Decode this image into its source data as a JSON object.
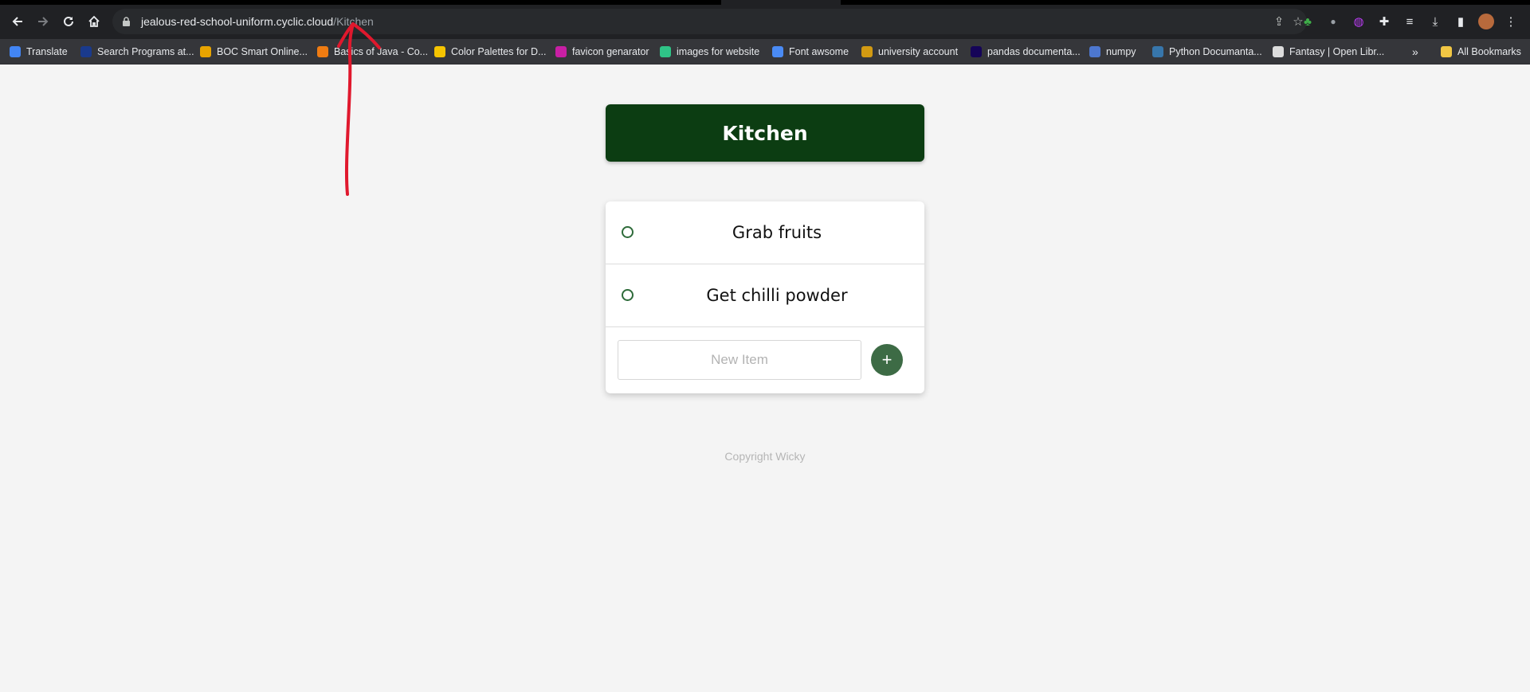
{
  "browser": {
    "url_host": "jealous-red-school-uniform.cyclic.cloud",
    "url_path": "/Kitchen",
    "nav": {
      "back_icon": "arrow-left-icon",
      "forward_icon": "arrow-right-icon",
      "reload_icon": "reload-icon",
      "home_icon": "home-icon"
    },
    "bookmarks": [
      {
        "label": "Translate",
        "color": "#4285f4"
      },
      {
        "label": "Search Programs at...",
        "color": "#1a3a8c"
      },
      {
        "label": "BOC Smart Online...",
        "color": "#e8a400"
      },
      {
        "label": "Basics of Java - Co...",
        "color": "#f07c12"
      },
      {
        "label": "Color Palettes for D...",
        "color": "#f5c400"
      },
      {
        "label": "favicon genarator",
        "color": "#c81fa4"
      },
      {
        "label": "images for website",
        "color": "#2fc487"
      },
      {
        "label": "Font awsome",
        "color": "#4a8bf5"
      },
      {
        "label": "university account",
        "color": "#d29a12"
      },
      {
        "label": "pandas documenta...",
        "color": "#150458"
      },
      {
        "label": "numpy",
        "color": "#4d77cf"
      },
      {
        "label": "Python Documanta...",
        "color": "#3776ab"
      },
      {
        "label": "Fantasy | Open Libr...",
        "color": "#dcdcdc"
      }
    ],
    "all_bookmarks_label": "All Bookmarks"
  },
  "page": {
    "list_title": "Kitchen",
    "items": [
      {
        "text": "Grab fruits"
      },
      {
        "text": "Get chilli powder"
      }
    ],
    "new_item_placeholder": "New Item",
    "add_button_symbol": "+",
    "footer": "Copyright Wicky"
  },
  "colors": {
    "title_bg": "#0c3d12",
    "accent": "#3d6b45",
    "annotation": "#e0182d"
  }
}
